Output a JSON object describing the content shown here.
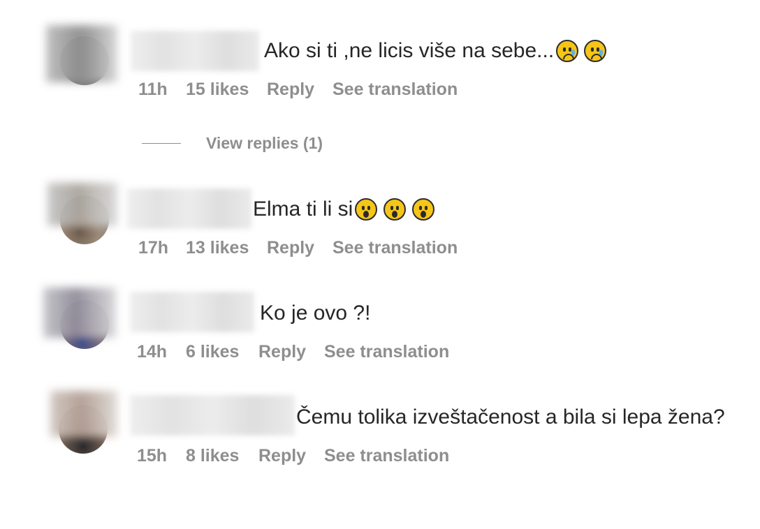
{
  "comments": [
    {
      "text": "Ako si ti ,ne licis više na sebe...",
      "emojis": [
        "sad-tear-emoji",
        "sad-tear-emoji"
      ],
      "time": "11h",
      "likes": "15 likes",
      "reply": "Reply",
      "translate": "See translation"
    },
    {
      "text": "Elma ti li si",
      "emojis": [
        "hushed-face-emoji",
        "hushed-face-emoji",
        "hushed-face-emoji"
      ],
      "time": "17h",
      "likes": "13 likes",
      "reply": "Reply",
      "translate": "See translation"
    },
    {
      "text": "Ko je ovo ?!",
      "emojis": [],
      "time": "14h",
      "likes": "6 likes",
      "reply": "Reply",
      "translate": "See translation"
    },
    {
      "text": "Čemu tolika izveštačenost a bila si lepa žena?",
      "emojis": [],
      "time": "15h",
      "likes": "8 likes",
      "reply": "Reply",
      "translate": "See translation"
    }
  ],
  "view_replies": "View replies (1)",
  "colors": {
    "text": "#262626",
    "meta": "#8e8e8e",
    "emoji_yellow": "#f5c518"
  }
}
